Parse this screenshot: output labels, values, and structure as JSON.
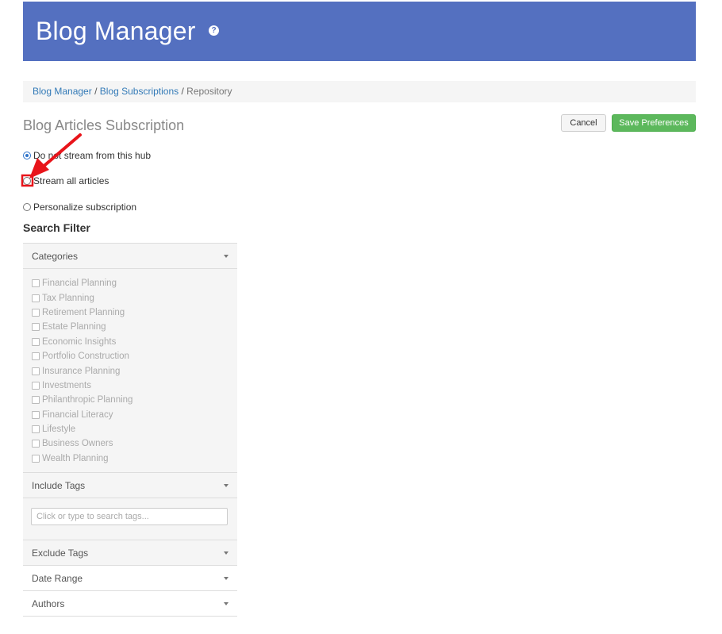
{
  "header": {
    "title": "Blog Manager",
    "help_icon": "question-circle-icon",
    "help_glyph": "?",
    "bg_color": "#5470c0"
  },
  "breadcrumb": {
    "items": [
      "Blog Manager",
      "Blog Subscriptions",
      "Repository"
    ],
    "separator": "/"
  },
  "page": {
    "heading": "Blog Articles Subscription"
  },
  "actions": {
    "cancel_label": "Cancel",
    "save_label": "Save Preferences",
    "save_color": "#5cb85c"
  },
  "subscription_options": [
    {
      "label": "Do not stream from this hub",
      "selected": true
    },
    {
      "label": "Stream all articles",
      "selected": false
    },
    {
      "label": "Personalize subscription",
      "selected": false
    }
  ],
  "search_filter": {
    "title": "Search Filter",
    "sections": {
      "categories": "Categories",
      "include_tags": "Include Tags",
      "exclude_tags": "Exclude Tags",
      "date_range": "Date Range",
      "authors": "Authors"
    },
    "categories": [
      "Financial Planning",
      "Tax Planning",
      "Retirement Planning",
      "Estate Planning",
      "Economic Insights",
      "Portfolio Construction",
      "Insurance Planning",
      "Investments",
      "Philanthropic Planning",
      "Financial Literacy",
      "Lifestyle",
      "Business Owners",
      "Wealth Planning"
    ],
    "include_tags_placeholder": "Click or type to search tags..."
  },
  "annotation": {
    "arrow_color": "#e8141a",
    "highlight_target": "Stream all articles"
  }
}
